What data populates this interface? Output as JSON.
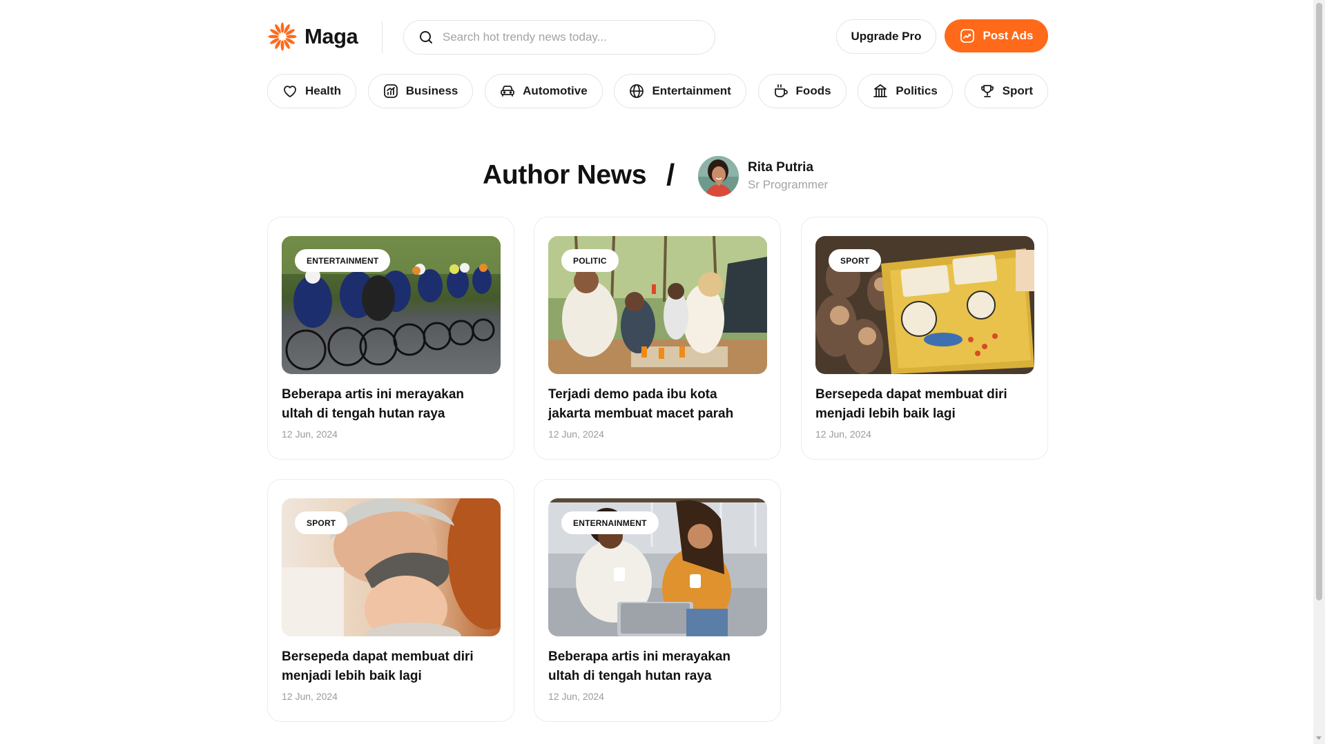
{
  "brand": {
    "name": "Maga",
    "accent": "#ff6a1a"
  },
  "search": {
    "placeholder": "Search hot trendy news today..."
  },
  "header": {
    "upgrade_label": "Upgrade Pro",
    "post_label": "Post Ads"
  },
  "categories": [
    {
      "label": "Health",
      "icon": "heart-icon"
    },
    {
      "label": "Business",
      "icon": "chart-icon"
    },
    {
      "label": "Automotive",
      "icon": "car-icon"
    },
    {
      "label": "Entertainment",
      "icon": "globe-icon"
    },
    {
      "label": "Foods",
      "icon": "cup-icon"
    },
    {
      "label": "Politics",
      "icon": "building-icon"
    },
    {
      "label": "Sport",
      "icon": "trophy-icon"
    }
  ],
  "page": {
    "title": "Author News",
    "separator": "/"
  },
  "author": {
    "name": "Rita Putria",
    "role": "Sr Programmer"
  },
  "articles": [
    {
      "badge": "ENTERTAINMENT",
      "title": "Beberapa artis ini merayakan ultah di tengah hutan raya",
      "date": "12 Jun, 2024",
      "image": "cyclists-race"
    },
    {
      "badge": "POLITIC",
      "title": "Terjadi demo pada ibu kota jakarta membuat macet parah",
      "date": "12 Jun, 2024",
      "image": "friends-picnic-toast"
    },
    {
      "badge": "SPORT",
      "title": "Bersepeda dapat membuat diri menjadi lebih baik lagi",
      "date": "12 Jun, 2024",
      "image": "protest-sign-crowd"
    },
    {
      "badge": "SPORT",
      "title": "Bersepeda dapat membuat diri menjadi lebih baik lagi",
      "date": "12 Jun, 2024",
      "image": "father-and-baby"
    },
    {
      "badge": "ENTERNAINMENT",
      "title": "Beberapa artis ini merayakan ultah di tengah hutan raya",
      "date": "12 Jun, 2024",
      "image": "women-on-couch"
    }
  ]
}
